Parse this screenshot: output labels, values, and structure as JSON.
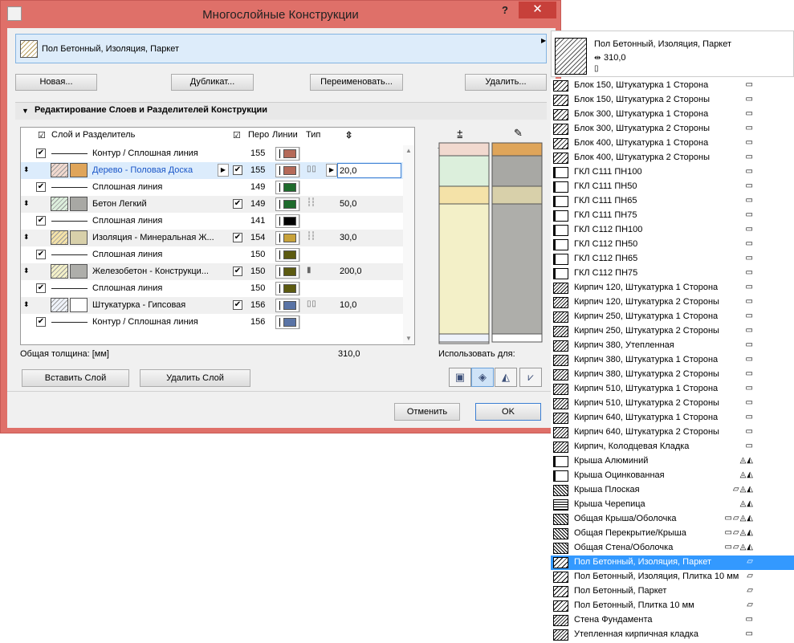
{
  "window": {
    "title": "Многослойные Конструкции",
    "help_glyph": "?",
    "close_glyph": "✕"
  },
  "composite": {
    "name": "Пол Бетонный, Изоляция, Паркет"
  },
  "buttons": {
    "new": "Новая...",
    "duplicate": "Дубликат...",
    "rename": "Переименовать...",
    "delete": "Удалить...",
    "insert_layer": "Вставить Слой",
    "delete_layer": "Удалить Слой",
    "cancel": "Отменить",
    "ok": "OK"
  },
  "section": {
    "title": "Редактирование Слоев и Разделителей Конструкции"
  },
  "table": {
    "headers": {
      "layer": "Слой и Разделитель",
      "pen": "Перо",
      "lines": "Линии",
      "type": "Тип"
    },
    "rows": [
      {
        "kind": "line",
        "checked": true,
        "name": "Контур / Сплошная линия",
        "pen": "155",
        "color": "#b56a59"
      },
      {
        "kind": "layer",
        "selected": true,
        "name": "Дерево - Половая Доска",
        "pen": "155",
        "color": "#b56a59",
        "fill": "#f1d9cf",
        "fill2": "#dfa55a",
        "thickness": "20,0",
        "type": "core"
      },
      {
        "kind": "line",
        "checked": true,
        "name": "Сплошная линия",
        "pen": "149",
        "color": "#1e6b2c"
      },
      {
        "kind": "layer",
        "name": "Бетон Легкий",
        "pen": "149",
        "color": "#1e6b2c",
        "fill": "#dcefdc",
        "fill2": "#a8a8a4",
        "thickness": "50,0",
        "type": "skin"
      },
      {
        "kind": "line",
        "checked": true,
        "name": "Сплошная линия",
        "pen": "141",
        "color": "#000000"
      },
      {
        "kind": "layer",
        "name": "Изоляция - Минеральная Ж...",
        "pen": "154",
        "color": "#c8a23a",
        "fill": "#f4e2a8",
        "fill2": "#d8d0aa",
        "thickness": "30,0",
        "type": "skin"
      },
      {
        "kind": "line",
        "checked": true,
        "name": "Сплошная линия",
        "pen": "150",
        "color": "#5c5a10"
      },
      {
        "kind": "layer",
        "name": "Железобетон - Конструкци...",
        "pen": "150",
        "color": "#5c5a10",
        "fill": "#f3f0c8",
        "fill2": "#aeaeaa",
        "thickness": "200,0",
        "type": "finish"
      },
      {
        "kind": "line",
        "checked": true,
        "name": "Сплошная линия",
        "pen": "150",
        "color": "#5c5a10"
      },
      {
        "kind": "layer",
        "name": "Штукатурка - Гипсовая",
        "pen": "156",
        "color": "#5a74a6",
        "fill": "#eef2fa",
        "fill2": "#ffffff",
        "thickness": "10,0",
        "type": "core"
      },
      {
        "kind": "line",
        "checked": true,
        "name": "Контур / Сплошная линия",
        "pen": "156",
        "color": "#5a74a6"
      }
    ]
  },
  "total": {
    "label": "Общая толщина: [мм]",
    "value": "310,0"
  },
  "use_for": {
    "label": "Использовать для:"
  },
  "side": {
    "name": "Пол Бетонный, Изоляция, Паркет",
    "thickness": "310,0"
  },
  "list": [
    {
      "name": "Блок 150, Штукатурка 1 Сторона",
      "swatch": "hatch",
      "flags": "▭"
    },
    {
      "name": "Блок 150, Штукатурка 2 Стороны",
      "swatch": "hatch",
      "flags": "▭"
    },
    {
      "name": "Блок 300, Штукатурка 1 Сторона",
      "swatch": "hatch",
      "flags": "▭"
    },
    {
      "name": "Блок 300, Штукатурка 2 Стороны",
      "swatch": "hatch",
      "flags": "▭"
    },
    {
      "name": "Блок 400, Штукатурка 1 Сторона",
      "swatch": "hatch",
      "flags": "▭"
    },
    {
      "name": "Блок 400, Штукатурка 2 Стороны",
      "swatch": "hatch",
      "flags": "▭"
    },
    {
      "name": "ГКЛ С111 ПН100",
      "swatch": "ghk",
      "flags": "▭"
    },
    {
      "name": "ГКЛ С111 ПН50",
      "swatch": "ghk",
      "flags": "▭"
    },
    {
      "name": "ГКЛ С111 ПН65",
      "swatch": "ghk",
      "flags": "▭"
    },
    {
      "name": "ГКЛ С111 ПН75",
      "swatch": "ghk",
      "flags": "▭"
    },
    {
      "name": "ГКЛ С112 ПН100",
      "swatch": "ghk",
      "flags": "▭"
    },
    {
      "name": "ГКЛ С112 ПН50",
      "swatch": "ghk",
      "flags": "▭"
    },
    {
      "name": "ГКЛ С112 ПН65",
      "swatch": "ghk",
      "flags": "▭"
    },
    {
      "name": "ГКЛ С112 ПН75",
      "swatch": "ghk",
      "flags": "▭"
    },
    {
      "name": "Кирпич 120, Штукатурка 1 Сторона",
      "swatch": "hatch2",
      "flags": "▭"
    },
    {
      "name": "Кирпич 120, Штукатурка 2 Стороны",
      "swatch": "hatch2",
      "flags": "▭"
    },
    {
      "name": "Кирпич 250, Штукатурка 1 Сторона",
      "swatch": "hatch2",
      "flags": "▭"
    },
    {
      "name": "Кирпич 250, Штукатурка 2 Стороны",
      "swatch": "hatch2",
      "flags": "▭"
    },
    {
      "name": "Кирпич 380, Утепленная",
      "swatch": "hatch2",
      "flags": "▭"
    },
    {
      "name": "Кирпич 380, Штукатурка 1 Сторона",
      "swatch": "hatch2",
      "flags": "▭"
    },
    {
      "name": "Кирпич 380, Штукатурка 2 Стороны",
      "swatch": "hatch2",
      "flags": "▭"
    },
    {
      "name": "Кирпич 510, Штукатурка 1 Сторона",
      "swatch": "hatch2",
      "flags": "▭"
    },
    {
      "name": "Кирпич 510, Штукатурка 2 Стороны",
      "swatch": "hatch2",
      "flags": "▭"
    },
    {
      "name": "Кирпич 640, Штукатурка 1 Сторона",
      "swatch": "hatch2",
      "flags": "▭"
    },
    {
      "name": "Кирпич 640, Штукатурка 2 Стороны",
      "swatch": "hatch2",
      "flags": "▭"
    },
    {
      "name": "Кирпич, Колодцевая Кладка",
      "swatch": "hatch2",
      "flags": "▭"
    },
    {
      "name": "Крыша Алюминий",
      "swatch": "ghk",
      "flags": "◬◭"
    },
    {
      "name": "Крыша Оцинкованная",
      "swatch": "ghk",
      "flags": "◬◭"
    },
    {
      "name": "Крыша Плоская",
      "swatch": "dense",
      "flags": "▱◬◭"
    },
    {
      "name": "Крыша Черепица",
      "swatch": "grid",
      "flags": "◬◭"
    },
    {
      "name": "Общая Крыша/Оболочка",
      "swatch": "dense",
      "flags": "▭▱◬◭"
    },
    {
      "name": "Общая Перекрытие/Крыша",
      "swatch": "dense",
      "flags": "▭▱◬◭"
    },
    {
      "name": "Общая Стена/Оболочка",
      "swatch": "dense",
      "flags": "▭▱◬◭"
    },
    {
      "name": "Пол Бетонный, Изоляция, Паркет",
      "swatch": "hatch",
      "flags": "▱",
      "selected": true
    },
    {
      "name": "Пол Бетонный, Изоляция, Плитка 10 мм",
      "swatch": "hatch",
      "flags": "▱"
    },
    {
      "name": "Пол Бетонный, Паркет",
      "swatch": "hatch",
      "flags": "▱"
    },
    {
      "name": "Пол Бетонный, Плитка 10 мм",
      "swatch": "hatch",
      "flags": "▱"
    },
    {
      "name": "Стена Фундамента",
      "swatch": "hatch2",
      "flags": "▭"
    },
    {
      "name": "Утепленная кирпичная кладка",
      "swatch": "hatch2",
      "flags": "▭"
    }
  ]
}
